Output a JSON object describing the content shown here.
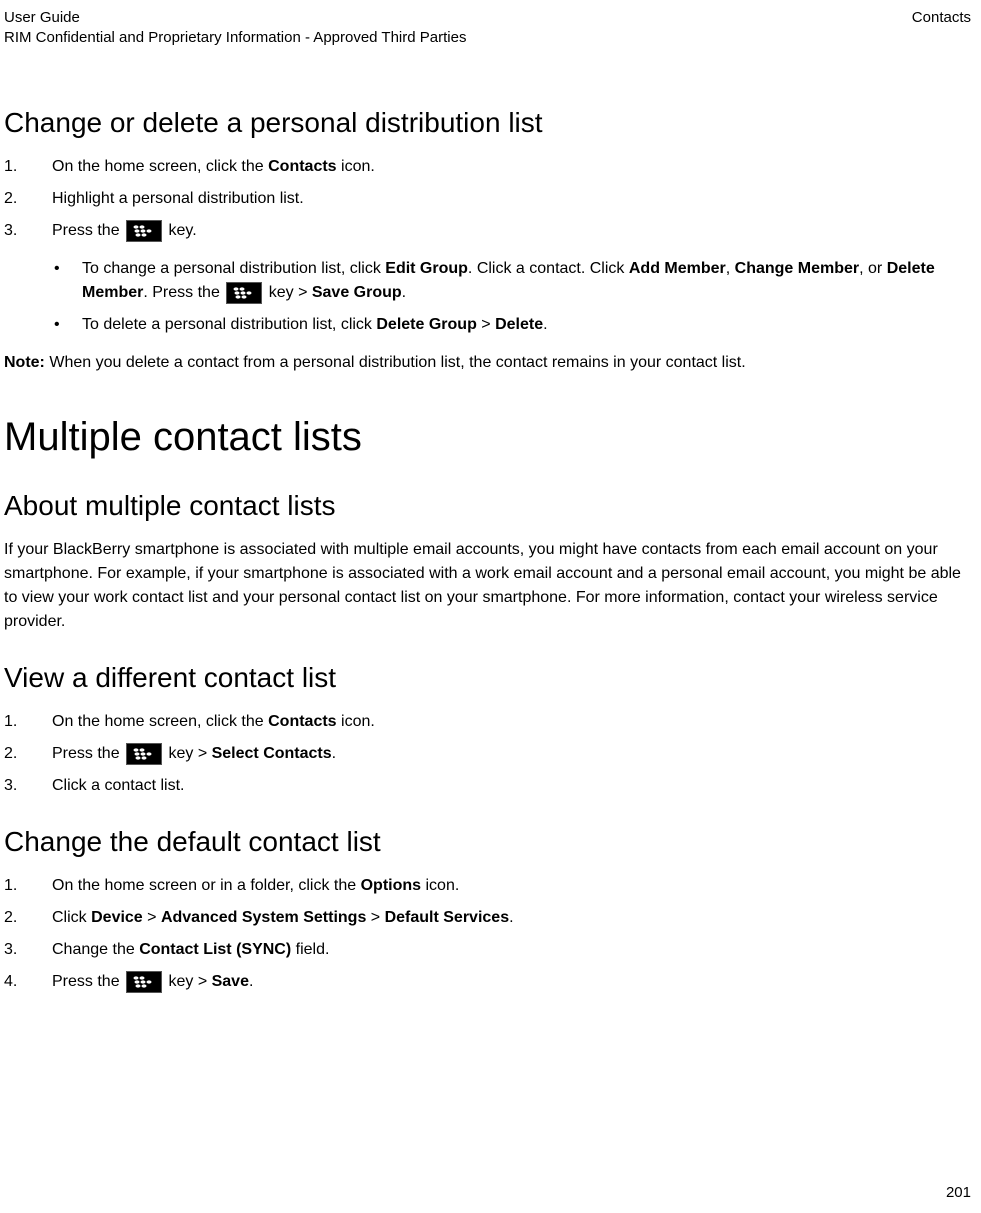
{
  "header": {
    "left_line1": "User Guide",
    "left_line2": "RIM Confidential and Proprietary Information - Approved Third Parties",
    "right": "Contacts"
  },
  "s1": {
    "title": "Change or delete a personal distribution list",
    "step1_a": "On the home screen, click the ",
    "step1_b": "Contacts",
    "step1_c": " icon.",
    "step2": "Highlight a personal distribution list.",
    "step3_a": "Press the ",
    "step3_b": " key.",
    "b1_a": "To change a personal distribution list, click ",
    "b1_b": "Edit Group",
    "b1_c": ". Click a contact. Click ",
    "b1_d": "Add Member",
    "b1_e": ", ",
    "b1_f": "Change Member",
    "b1_g": ", or ",
    "b1_h": "Delete Member",
    "b1_i": ". Press the ",
    "b1_j": " key > ",
    "b1_k": "Save Group",
    "b1_l": ".",
    "b2_a": "To delete a personal distribution list, click ",
    "b2_b": "Delete Group",
    "b2_c": " > ",
    "b2_d": "Delete",
    "b2_e": ".",
    "note_label": "Note:",
    "note_text": " When you delete a contact from a personal distribution list, the contact remains in your contact list."
  },
  "s2": {
    "big_title": "Multiple contact lists",
    "sub1_title": "About multiple contact lists",
    "sub1_body": "If your BlackBerry smartphone is associated with multiple email accounts, you might have contacts from each email account on your smartphone. For example, if your smartphone is associated with a work email account and a personal email account, you might be able to view your work contact list and your personal contact list on your smartphone. For more information, contact your wireless service provider.",
    "sub2_title": "View a different contact list",
    "sub2_step1_a": "On the home screen, click the ",
    "sub2_step1_b": "Contacts",
    "sub2_step1_c": " icon.",
    "sub2_step2_a": " Press the ",
    "sub2_step2_b": " key > ",
    "sub2_step2_c": "Select Contacts",
    "sub2_step2_d": ".",
    "sub2_step3": "Click a contact list.",
    "sub3_title": "Change the default contact list",
    "sub3_step1_a": "On the home screen or in a folder, click the ",
    "sub3_step1_b": "Options",
    "sub3_step1_c": " icon.",
    "sub3_step2_a": "Click ",
    "sub3_step2_b": "Device",
    "sub3_step2_c": " > ",
    "sub3_step2_d": "Advanced System Settings",
    "sub3_step2_e": " > ",
    "sub3_step2_f": "Default Services",
    "sub3_step2_g": ".",
    "sub3_step3_a": "Change the ",
    "sub3_step3_b": "Contact List (SYNC)",
    "sub3_step3_c": " field.",
    "sub3_step4_a": " Press the ",
    "sub3_step4_b": " key > ",
    "sub3_step4_c": "Save",
    "sub3_step4_d": "."
  },
  "page_number": "201"
}
